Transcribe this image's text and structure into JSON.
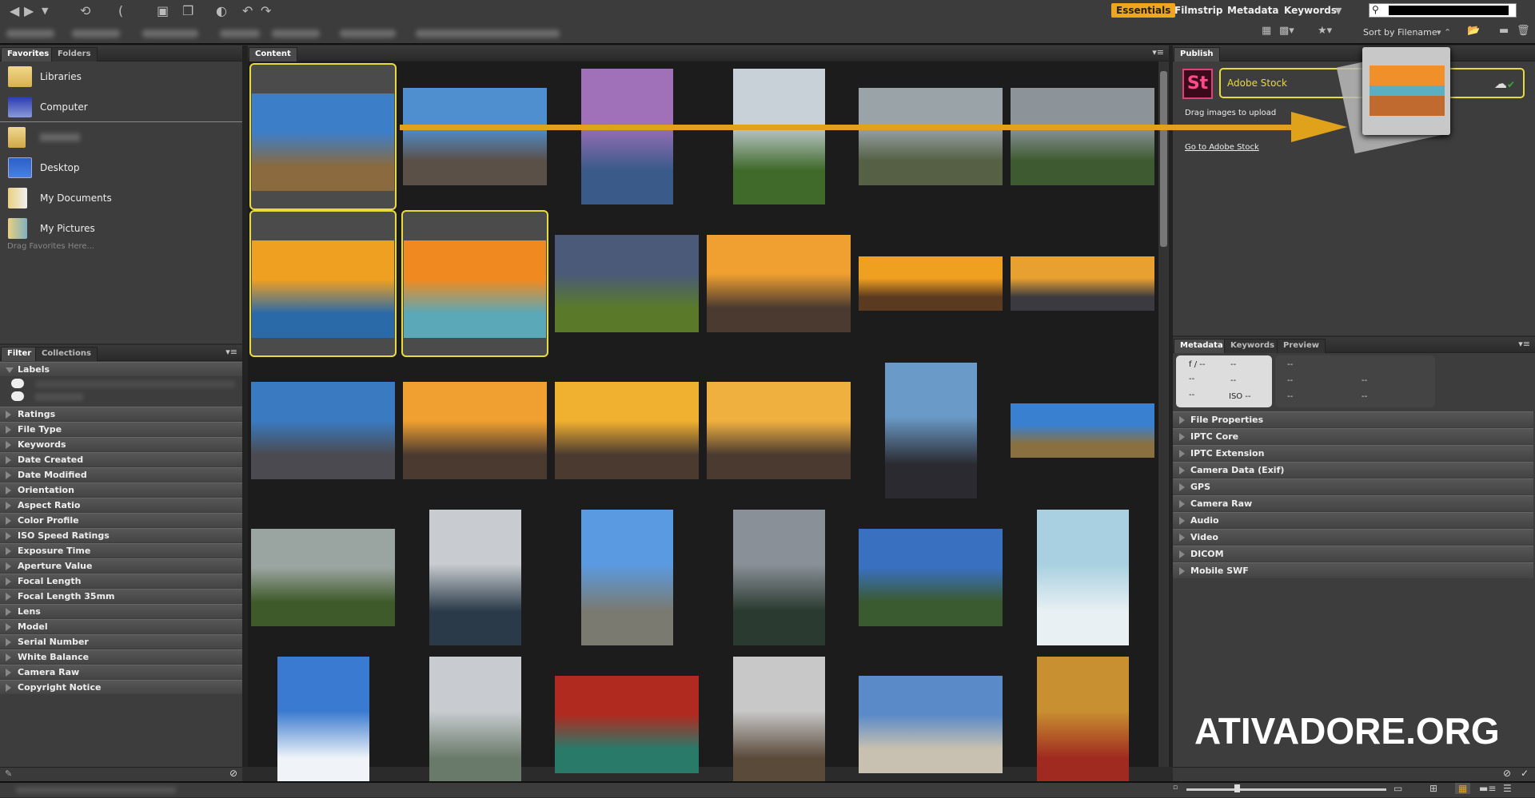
{
  "toolbar": {
    "workspaces": [
      "Essentials",
      "Filmstrip",
      "Metadata",
      "Keywords"
    ],
    "active_workspace": "Essentials",
    "sort_label": "Sort by Filename",
    "search_value": ""
  },
  "favorites_panel": {
    "tabs": [
      "Favorites",
      "Folders"
    ],
    "items": [
      "Libraries",
      "Computer",
      "Desktop",
      "My Documents",
      "My Pictures"
    ],
    "hint": "Drag Favorites Here..."
  },
  "filter_panel": {
    "tabs": [
      "Filter",
      "Collections"
    ],
    "sections": [
      "Labels",
      "Ratings",
      "File Type",
      "Keywords",
      "Date Created",
      "Date Modified",
      "Orientation",
      "Aspect Ratio",
      "Color Profile",
      "ISO Speed Ratings",
      "Exposure Time",
      "Aperture Value",
      "Focal Length",
      "Focal Length 35mm",
      "Lens",
      "Model",
      "Serial Number",
      "White Balance",
      "Camera Raw",
      "Copyright Notice"
    ]
  },
  "content_panel": {
    "tab": "Content",
    "thumbnails": [
      {
        "shape": "l",
        "colors": [
          "#3d7ec8",
          "#8a6a3e"
        ],
        "selected": true
      },
      {
        "shape": "l",
        "colors": [
          "#4f8fd0",
          "#5a5048"
        ],
        "selected": false
      },
      {
        "shape": "p",
        "colors": [
          "#a070b8",
          "#3a5a8a"
        ],
        "selected": false
      },
      {
        "shape": "p",
        "colors": [
          "#c8d0d8",
          "#3f6a2a"
        ],
        "selected": false
      },
      {
        "shape": "l",
        "colors": [
          "#9aa4a8",
          "#556045"
        ],
        "selected": false
      },
      {
        "shape": "l",
        "colors": [
          "#8c949a",
          "#3e5a30"
        ],
        "selected": false
      },
      {
        "shape": "l",
        "colors": [
          "#f0a020",
          "#2a6aa8"
        ],
        "selected": true
      },
      {
        "shape": "l",
        "colors": [
          "#f08a20",
          "#5aa8b8"
        ],
        "selected": true
      },
      {
        "shape": "l",
        "colors": [
          "#4a5a78",
          "#5a7a2a"
        ],
        "selected": false
      },
      {
        "shape": "l",
        "colors": [
          "#f0a030",
          "#4a3a30"
        ],
        "selected": false
      },
      {
        "shape": "w",
        "colors": [
          "#f0a020",
          "#5a3a20"
        ],
        "selected": false
      },
      {
        "shape": "w",
        "colors": [
          "#e8a030",
          "#3a3a40"
        ],
        "selected": false
      },
      {
        "shape": "l",
        "colors": [
          "#3a7ac0",
          "#4a4a50"
        ],
        "selected": false
      },
      {
        "shape": "l",
        "colors": [
          "#f0a030",
          "#4a3a30"
        ],
        "selected": false
      },
      {
        "shape": "l",
        "colors": [
          "#f0b030",
          "#4a3a30"
        ],
        "selected": false
      },
      {
        "shape": "l",
        "colors": [
          "#f0b040",
          "#4a3a30"
        ],
        "selected": false
      },
      {
        "shape": "p",
        "colors": [
          "#6a9ac8",
          "#2a2a30"
        ],
        "selected": false
      },
      {
        "shape": "w",
        "colors": [
          "#3a80d0",
          "#8a7040"
        ],
        "selected": false
      },
      {
        "shape": "l",
        "colors": [
          "#9aa4a0",
          "#3f5a2a"
        ],
        "selected": false
      },
      {
        "shape": "p",
        "colors": [
          "#c8ccd0",
          "#2a3a48"
        ],
        "selected": false
      },
      {
        "shape": "p",
        "colors": [
          "#5a9ae0",
          "#7a7a70"
        ],
        "selected": false
      },
      {
        "shape": "p",
        "colors": [
          "#8a9098",
          "#2a3a30"
        ],
        "selected": false
      },
      {
        "shape": "l",
        "colors": [
          "#3a70c0",
          "#3a5a30"
        ],
        "selected": false
      },
      {
        "shape": "p",
        "colors": [
          "#a8d0e0",
          "#e8f0f4"
        ],
        "selected": false
      },
      {
        "shape": "p",
        "colors": [
          "#3a7ad0",
          "#f0f4f8"
        ],
        "selected": false
      },
      {
        "shape": "p",
        "colors": [
          "#c8ccd0",
          "#6a7a6a"
        ],
        "selected": false
      },
      {
        "shape": "l",
        "colors": [
          "#b02a20",
          "#2a7a6a"
        ],
        "selected": false
      },
      {
        "shape": "p",
        "colors": [
          "#c8c8c8",
          "#5a4a3a"
        ],
        "selected": false
      },
      {
        "shape": "l",
        "colors": [
          "#5a8ac8",
          "#c8c0b0"
        ],
        "selected": false
      },
      {
        "shape": "p",
        "colors": [
          "#c89030",
          "#a02a20"
        ],
        "selected": false
      }
    ]
  },
  "publish_panel": {
    "tab": "Publish",
    "service": "Adobe Stock",
    "logo": "St",
    "hint": "Drag images to upload",
    "link": "Go to Adobe Stock",
    "accent": "#e8dc3c"
  },
  "metadata_panel": {
    "tabs": [
      "Metadata",
      "Keywords",
      "Preview"
    ],
    "placard": {
      "aperture": "f / --",
      "iso": "ISO --",
      "empty": "--"
    },
    "sections": [
      "File Properties",
      "IPTC Core",
      "IPTC Extension",
      "Camera Data (Exif)",
      "GPS",
      "Camera Raw",
      "Audio",
      "Video",
      "DICOM",
      "Mobile SWF"
    ]
  },
  "watermark": "ATIVADORE.ORG",
  "thumbnail_size_slider": 0.25
}
